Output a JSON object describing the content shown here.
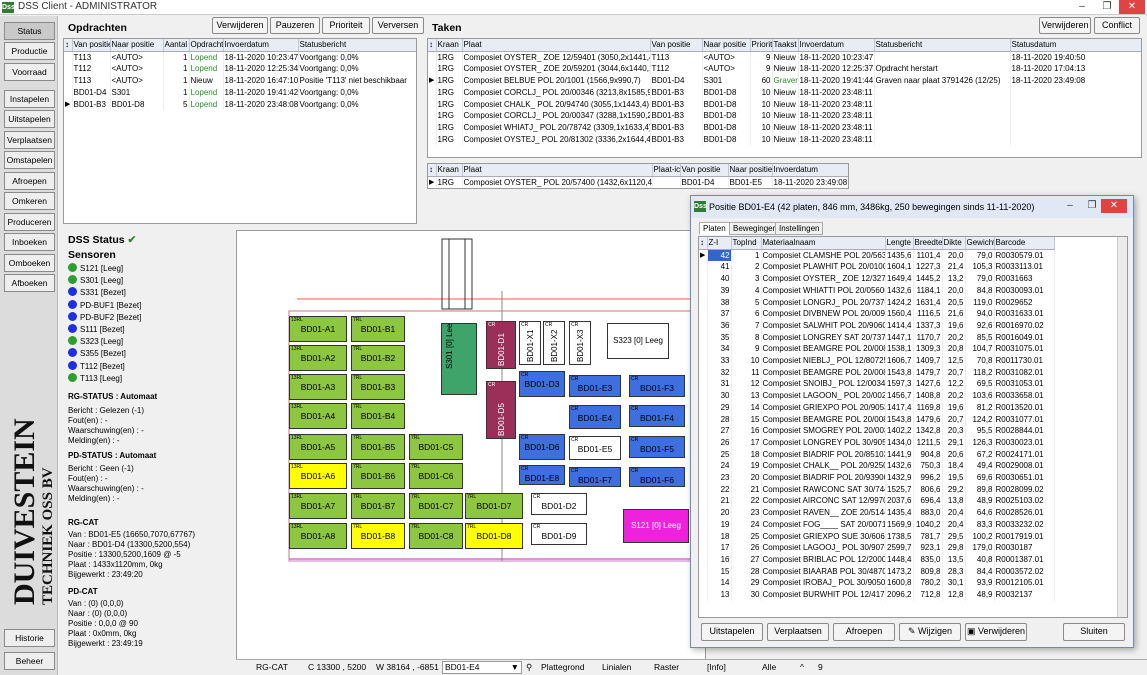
{
  "window": {
    "title": "DSS Client - ADMINISTRATOR",
    "logo_text": "Dss"
  },
  "nav": {
    "status": "Status",
    "producte": "Productie",
    "voorraad": "Voorraad",
    "instapelen": "Instapelen",
    "uitstapelen": "Uitstapelen",
    "verplaatsen": "Verplaatsen",
    "omstapelen": "Omstapelen",
    "afroepen": "Afroepen",
    "omkeren": "Omkeren",
    "produceren": "Produceren",
    "inboeken": "Inboeken",
    "omboeken": "Omboeken",
    "afboeken": "Afboeken",
    "historie": "Historie",
    "beheer": "Beheer"
  },
  "orders": {
    "title": "Opdrachten",
    "buttons": {
      "delete": "Verwijderen",
      "pause": "Pauzeren",
      "priority": "Prioriteit",
      "refresh": "Verversen"
    },
    "columns": [
      "Van positie",
      "Naar positie",
      "Aantal",
      "Opdracht",
      "Invoerdatum",
      "Statusbericht"
    ],
    "rows": [
      [
        "T113",
        "<AUTO>",
        "1",
        "Lopend",
        "18-11-2020 10:23:47",
        "Voortgang: 0,0%"
      ],
      [
        "T112",
        "<AUTO>",
        "1",
        "Lopend",
        "18-11-2020 12:25:34",
        "Voortgang: 0,0%"
      ],
      [
        "T113",
        "<AUTO>",
        "1",
        "Nieuw",
        "18-11-2020 16:47:10",
        "Positie 'T113' niet beschikbaar"
      ],
      [
        "BD01-D4",
        "S301",
        "1",
        "Lopend",
        "18-11-2020 19:41:42",
        "Voortgang: 0,0%"
      ],
      [
        "BD01-B3",
        "BD01-D8",
        "5",
        "Lopend",
        "18-11-2020 23:48:08",
        "Voortgang: 0,0%"
      ]
    ]
  },
  "tasks": {
    "title": "Taken",
    "buttons": {
      "delete": "Verwijderen",
      "conflict": "Conflict"
    },
    "columns": [
      "Kraan",
      "Plaat",
      "Van positie",
      "Naar positie",
      "Priorit",
      "Taakst",
      "Invoerdatum",
      "Statusbericht",
      "Statusdatum"
    ],
    "rows": [
      [
        "1RG",
        "Composiet OYSTER_ ZOE 12/59401 (3050,2x1441,4)",
        "T113",
        "<AUTO>",
        "9",
        "Nieuw",
        "18-11-2020 10:23:47",
        "",
        "18-11-2020 19:40:50"
      ],
      [
        "1RG",
        "Composiet OYSTER_ ZOE 20/59201 (3044,6x1440,1)",
        "T112",
        "<AUTO>",
        "9",
        "Nieuw",
        "18-11-2020 12:25:37",
        "Opdracht herstart",
        "18-11-2020 17:04:13"
      ],
      [
        "1RG",
        "Composiet BELBUE POL 20/1001 (1566,9x990,7)",
        "BD01-D4",
        "S301",
        "60",
        "Graver",
        "18-11-2020 19:41:44",
        "Graven naar plaat 3791426 (12/25)",
        "18-11-2020 23:49:08"
      ],
      [
        "1RG",
        "Composiet CORCLJ_ POL 20/00346 (3213,8x1585,9)",
        "BD01-B3",
        "BD01-D8",
        "10",
        "Nieuw",
        "18-11-2020 23:48:11",
        "",
        ""
      ],
      [
        "1RG",
        "Composiet CHALK_ POL 20/94740 (3055,1x1443,4)",
        "BD01-B3",
        "BD01-D8",
        "10",
        "Nieuw",
        "18-11-2020 23:48:11",
        "",
        ""
      ],
      [
        "1RG",
        "Composiet CORCLJ_ POL 20/00347 (3288,1x1590,2)",
        "BD01-B3",
        "BD01-D8",
        "10",
        "Nieuw",
        "18-11-2020 23:48:11",
        "",
        ""
      ],
      [
        "1RG",
        "Composiet WHIATJ_ POL 20/78742 (3309,1x1633,4)",
        "BD01-B3",
        "BD01-D8",
        "10",
        "Nieuw",
        "18-11-2020 23:48:11",
        "",
        ""
      ],
      [
        "1RG",
        "Composiet OYSTEJ_ POL 20/81302 (3336,2x1644,4)",
        "BD01-B3",
        "BD01-D8",
        "10",
        "Nieuw",
        "18-11-2020 23:48:11",
        "",
        ""
      ]
    ]
  },
  "subtask": {
    "columns": [
      "Kraan",
      "Plaat",
      "Plaat-ic",
      "Van positie",
      "Naar positie",
      "Invoerdatum"
    ],
    "rows": [
      [
        "1RG",
        "Composiet OYSTER_ POL 20/57400 (1432,6x1120,4)",
        "",
        "BD01-D4",
        "BD01-E5",
        "18-11-2020 23:49:08"
      ]
    ]
  },
  "status": {
    "title": "DSS Status",
    "sensors_title": "Sensoren",
    "sensors": [
      {
        "label": "S121 [Leeg]",
        "color": "#2e9e2e"
      },
      {
        "label": "S301 [Leeg]",
        "color": "#2e9e2e"
      },
      {
        "label": "S331 [Bezet]",
        "color": "#1e2ee0"
      },
      {
        "label": "PD-BUF1 [Bezet]",
        "color": "#1e2ee0"
      },
      {
        "label": "PD-BUF2 [Bezet]",
        "color": "#1e2ee0"
      },
      {
        "label": "S111 [Bezet]",
        "color": "#1e2ee0"
      },
      {
        "label": "S323 [Leeg]",
        "color": "#2e9e2e"
      },
      {
        "label": "S355 [Bezet]",
        "color": "#1e2ee0"
      },
      {
        "label": "T112 [Bezet]",
        "color": "#1e2ee0"
      },
      {
        "label": "T113 [Leeg]",
        "color": "#2e9e2e"
      }
    ],
    "rg_status_title": "RG-STATUS : Automaat",
    "rg_status_lines": [
      "Bericht : Gelezen (-1)",
      "Fout(en) : -",
      "Waarschuwing(en) : -",
      "Melding(en) : -"
    ],
    "pd_status_title": "PD-STATUS : Automaat",
    "pd_status_lines": [
      "Bericht : Geen (-1)",
      "Fout(en) : -",
      "Waarschuwing(en) : -",
      "Melding(en) : -"
    ],
    "rg_cat_title": "RG-CAT",
    "rg_cat_lines": [
      "Van : BD01-E5 (16650,7070,67767)",
      "Naar : BD01-D4 (13300,5200,554)",
      "Positie : 13300,5200,1609 @ -5",
      "Plaat : 1433x1120mm, 0kg",
      "Bijgewerkt : 23:49:20"
    ],
    "pd_cat_title": "PD-CAT",
    "pd_cat_lines": [
      "Van : (0) (0,0,0)",
      "Naar : (0) (0,0,0)",
      "Positie : 0,0,0 @ 90",
      "Plaat : 0x0mm, 0kg",
      "Bijgewerkt : 23:49:19"
    ]
  },
  "brand": {
    "line1": "DUIVESTEIN",
    "line2": "TECHNIEK OSS BV"
  },
  "map": {
    "positions": [
      {
        "id": "BD01-A1",
        "color": "#8dc63f",
        "label": "13RL"
      },
      {
        "id": "BD01-B1",
        "color": "#8dc63f",
        "label": "7RL"
      },
      {
        "id": "BD01-A2",
        "color": "#8dc63f",
        "label": "13RL"
      },
      {
        "id": "BD01-B2",
        "color": "#8dc63f",
        "label": "7RL"
      },
      {
        "id": "BD01-A3",
        "color": "#8dc63f",
        "label": "13RL"
      },
      {
        "id": "BD01-B3",
        "color": "#8dc63f",
        "label": "7RL"
      },
      {
        "id": "BD01-A4",
        "color": "#8dc63f",
        "label": "13RL"
      },
      {
        "id": "BD01-B4",
        "color": "#8dc63f",
        "label": "7RL"
      },
      {
        "id": "BD01-A5",
        "color": "#8dc63f",
        "label": "13RL"
      },
      {
        "id": "BD01-B5",
        "color": "#8dc63f",
        "label": "7RL"
      },
      {
        "id": "BD01-C5",
        "color": "#8dc63f",
        "label": "7RL"
      },
      {
        "id": "BD01-A6",
        "color": "#ffff00",
        "label": "13RL"
      },
      {
        "id": "BD01-B6",
        "color": "#8dc63f",
        "label": "7RL"
      },
      {
        "id": "BD01-C6",
        "color": "#8dc63f",
        "label": "7RL"
      },
      {
        "id": "BD01-A7",
        "color": "#8dc63f",
        "label": "13RL"
      },
      {
        "id": "BD01-B7",
        "color": "#8dc63f",
        "label": "7RL"
      },
      {
        "id": "BD01-C7",
        "color": "#8dc63f",
        "label": "7RL"
      },
      {
        "id": "BD01-D7",
        "color": "#8dc63f",
        "label": "7RL"
      },
      {
        "id": "BD01-A8",
        "color": "#8dc63f",
        "label": "13RL"
      },
      {
        "id": "BD01-B8",
        "color": "#ffff00",
        "label": "7RL"
      },
      {
        "id": "BD01-C8",
        "color": "#8dc63f",
        "label": "7RL"
      },
      {
        "id": "BD01-D8",
        "color": "#ffff00",
        "label": "7RL"
      },
      {
        "id": "BD01-D1",
        "color": "#9b2f5a",
        "label": "CR"
      },
      {
        "id": "BD01-D5",
        "color": "#9b2f5a",
        "label": "CR"
      },
      {
        "id": "BD01-X1",
        "color": "#ffffff",
        "label": "CR"
      },
      {
        "id": "BD01-X2",
        "color": "#ffffff",
        "label": "CR"
      },
      {
        "id": "BD01-X3",
        "color": "#ffffff",
        "label": "CR"
      },
      {
        "id": "BD01-D3",
        "color": "#3d6fe0",
        "label": "CR"
      },
      {
        "id": "BD01-E3",
        "color": "#3d6fe0",
        "label": "CR"
      },
      {
        "id": "BD01-F3",
        "color": "#3d6fe0",
        "label": "CR"
      },
      {
        "id": "BD01-E4",
        "color": "#3d6fe0",
        "label": "CR"
      },
      {
        "id": "BD01-F4",
        "color": "#3d6fe0",
        "label": "CR"
      },
      {
        "id": "BD01-D6",
        "color": "#3d6fe0",
        "label": "CR"
      },
      {
        "id": "BD01-E5",
        "color": "#ffffff",
        "label": "CR"
      },
      {
        "id": "BD01-F5",
        "color": "#3d6fe0",
        "label": "CR"
      },
      {
        "id": "BD01-E8",
        "color": "#3d6fe0",
        "label": "CR"
      },
      {
        "id": "BD01-F7",
        "color": "#3d6fe0",
        "label": "CR"
      },
      {
        "id": "BD01-F6",
        "color": "#3d6fe0",
        "label": "CR"
      },
      {
        "id": "BD01-D2",
        "color": "#ffffff",
        "label": "CR"
      },
      {
        "id": "BD01-D9",
        "color": "#ffffff",
        "label": "CR"
      }
    ],
    "s301": "S301 [0] Leeg",
    "s323": "S323 [0] Leeg",
    "s121": "S121 [0] Leeg",
    "crane_label": "RG-CAT"
  },
  "statusbar": {
    "crane": "RG-CAT",
    "c": "C 13300 , 5200",
    "w": "W 38164 , -6851",
    "position": "BD01-E4",
    "plattegrond": "Plattegrond",
    "linialen": "Linialen",
    "raster": "Raster",
    "info": "[Info]",
    "alle": "Alle",
    "caret": "^",
    "nine": "9"
  },
  "dialog": {
    "title": "Positie BD01-E4 (42 platen, 846 mm, 3486kg, 250 bewegingen sinds 11-11-2020)",
    "tabs": [
      "Platen",
      "Bewegingen",
      "Instellingen"
    ],
    "columns": [
      "Z-I",
      "TopInd",
      "Materiaalnaam",
      "Lengte",
      "Breedte",
      "Dikte",
      "Gewicht",
      "Barcode"
    ],
    "rows": [
      [
        "42",
        "1",
        "Composiet CLAMSHE POL 20/56301",
        "1435,6",
        "1101,4",
        "20,0",
        "79,0",
        "R0030579.01"
      ],
      [
        "41",
        "2",
        "Composiet PLAWHIT POL 20/01002",
        "1604,1",
        "1227,3",
        "21,4",
        "105,3",
        "R0033113.01"
      ],
      [
        "40",
        "3",
        "Composiet OYSTER_ ZOE 12/32701",
        "1649,4",
        "1445,2",
        "13,2",
        "79,0",
        "R0031663"
      ],
      [
        "39",
        "4",
        "Composiet WHIATTI POL 20/05600",
        "1432,6",
        "1184,1",
        "20,0",
        "84,8",
        "R0030093.01"
      ],
      [
        "38",
        "5",
        "Composiet LONGRJ_ POL 20/73701",
        "1424,2",
        "1631,4",
        "20,5",
        "119,0",
        "R0029652"
      ],
      [
        "37",
        "6",
        "Composiet DIVBNEW POL 20/00915",
        "1560,4",
        "1116,5",
        "21,6",
        "94,0",
        "R0031633.01"
      ],
      [
        "36",
        "7",
        "Composiet SALWHIT POL 20/90604",
        "1414,4",
        "1337,3",
        "19,6",
        "92,6",
        "R0016970.02"
      ],
      [
        "35",
        "8",
        "Composiet LONGREY SAT 20/73740",
        "1447,1",
        "1170,7",
        "20,2",
        "85,5",
        "R0016049.01"
      ],
      [
        "34",
        "9",
        "Composiet BEAMGRE POL 20/00831",
        "1538,1",
        "1309,3",
        "20,8",
        "104,7",
        "R0031075.01"
      ],
      [
        "33",
        "10",
        "Composiet NIEBLJ_ POL 12/80725",
        "1606,7",
        "1409,7",
        "12,5",
        "70,8",
        "R0011730.01"
      ],
      [
        "32",
        "11",
        "Composiet BEAMGRE POL 20/00831",
        "1543,8",
        "1479,7",
        "20,7",
        "118,2",
        "R0031082.01"
      ],
      [
        "31",
        "12",
        "Composiet SNOIBJ_ POL 12/00342",
        "1597,3",
        "1427,6",
        "12,2",
        "69,5",
        "R0031053.01"
      ],
      [
        "30",
        "13",
        "Composiet LAGOON_ POL 20/00210",
        "1456,7",
        "1408,8",
        "20,2",
        "103,6",
        "R0033658.01"
      ],
      [
        "29",
        "14",
        "Composiet GRIEXPO POL 20/90530",
        "1417,4",
        "1169,8",
        "19,6",
        "81,2",
        "R0013520.01"
      ],
      [
        "28",
        "15",
        "Composiet BEAMGRE POL 20/00831",
        "1543,8",
        "1479,6",
        "20,7",
        "124,2",
        "R0031077.01"
      ],
      [
        "27",
        "16",
        "Composiet SMOGREY POL 20/00311",
        "1402,2",
        "1342,8",
        "20,3",
        "95,5",
        "R0028844.01"
      ],
      [
        "26",
        "17",
        "Composiet LONGREY POL 30/90541",
        "1434,0",
        "1211,5",
        "29,1",
        "126,3",
        "R0030023.01"
      ],
      [
        "25",
        "18",
        "Composiet BIADRIF POL 20/85103",
        "1441,9",
        "904,8",
        "20,6",
        "67,2",
        "R0024171.01"
      ],
      [
        "24",
        "19",
        "Composiet CHALK__ POL 20/92501",
        "1432,6",
        "750,3",
        "18,4",
        "49,4",
        "R0029008.01"
      ],
      [
        "23",
        "20",
        "Composiet BIADRIF POL 20/93900",
        "1432,9",
        "996,2",
        "19,5",
        "69,6",
        "R0030651.01"
      ],
      [
        "22",
        "21",
        "Composiet RAWCONC SAT 30/74400",
        "1525,7",
        "806,6",
        "29,2",
        "89,8",
        "R0028099.02"
      ],
      [
        "21",
        "22",
        "Composiet AIRCONC SAT 12/99700",
        "2037,6",
        "696,4",
        "13,8",
        "48,9",
        "R0025103.02"
      ],
      [
        "20",
        "23",
        "Composiet RAVEN__ ZOE 20/51442",
        "1435,4",
        "883,0",
        "20,4",
        "64,6",
        "R0028526.01"
      ],
      [
        "19",
        "24",
        "Composiet FOG____ SAT 20/00715",
        "1569,9",
        "1040,2",
        "20,4",
        "83,3",
        "R0033232.02"
      ],
      [
        "18",
        "25",
        "Composiet GRIEXPO SUE 30/60602",
        "1738,5",
        "781,7",
        "29,5",
        "100,2",
        "R0017919.01"
      ],
      [
        "17",
        "26",
        "Composiet LAGOOJ_ POL 30/90701",
        "2599,7",
        "923,1",
        "29,8",
        "179,0",
        "R0030187"
      ],
      [
        "16",
        "27",
        "Composiet BRIBLAC POL 12/20000",
        "1448,4",
        "835,0",
        "13,5",
        "40,8",
        "R0001387.01"
      ],
      [
        "15",
        "28",
        "Composiet BIAARAB POL 30/48700",
        "1473,2",
        "809,8",
        "28,3",
        "84,4",
        "R0003572.02"
      ],
      [
        "14",
        "29",
        "Composiet IROBAJ_ POL 30/90501",
        "1600,8",
        "780,2",
        "30,1",
        "93,9",
        "R0012105.01"
      ],
      [
        "13",
        "30",
        "Composiet BURWHIT POL 12/41700",
        "2096,2",
        "712,8",
        "12,8",
        "48,9",
        "R0032137"
      ]
    ],
    "buttons": {
      "uitstapelen": "Uitstapelen",
      "verplaatsen": "Verplaatsen",
      "afroepen": "Afroepen",
      "wijzigen": "Wijzigen",
      "verwijderen": "Verwijderen",
      "sluiten": "Sluiten"
    }
  }
}
